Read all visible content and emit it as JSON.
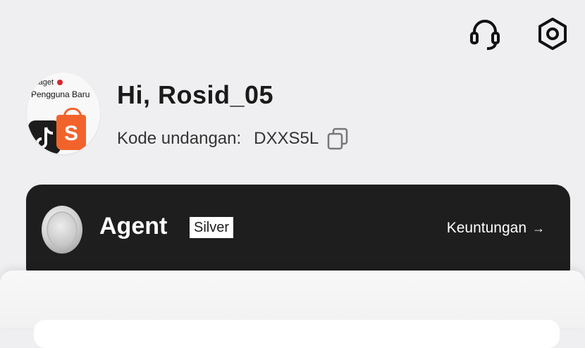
{
  "header": {
    "support_icon": "headset-icon",
    "settings_icon": "settings-gear-icon"
  },
  "profile": {
    "avatar_line1": "ng Kaget",
    "avatar_line2": "Pengguna Baru",
    "greeting": "Hi, Rosid_05",
    "invite_label": "Kode undangan:",
    "invite_code": "DXXS5L",
    "copy_icon": "copy-icon"
  },
  "agent_card": {
    "title": "Agent",
    "tier": "Silver",
    "benefit_link": "Keuntungan",
    "arrow": "→",
    "medal_icon": "silver-medal-icon"
  },
  "colors": {
    "background": "#efeff1",
    "card": "#1e1e1e",
    "shopee_orange": "#f2632c"
  }
}
